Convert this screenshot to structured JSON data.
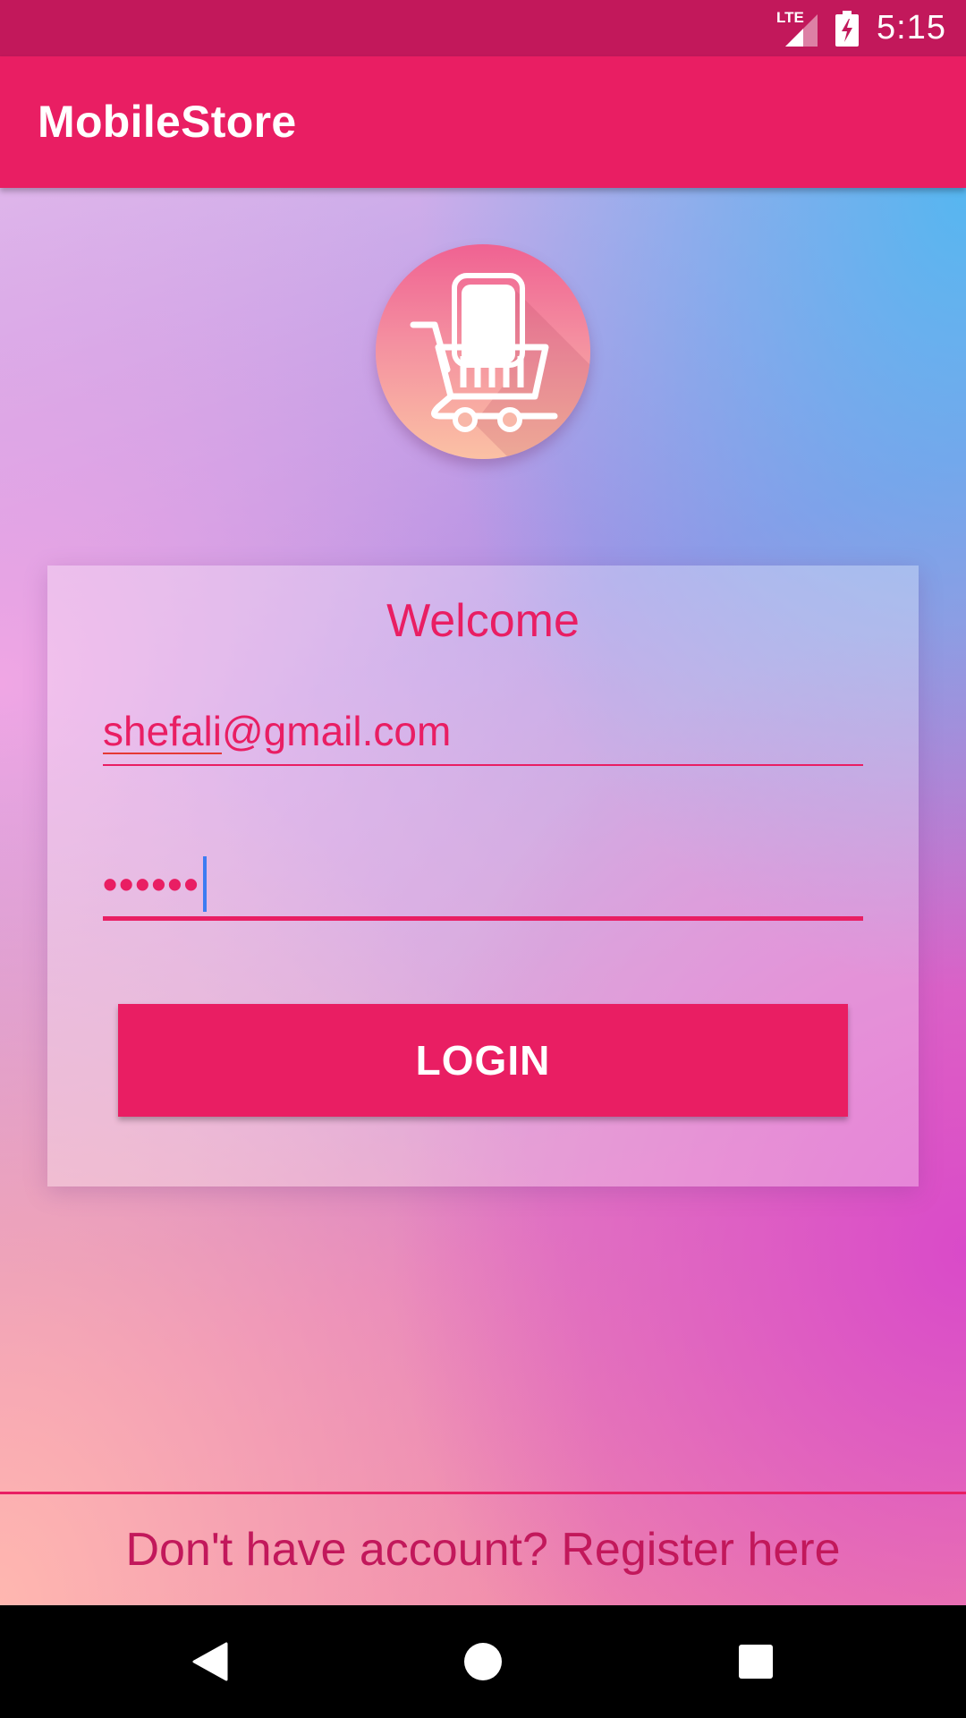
{
  "status_bar": {
    "network": "LTE",
    "time": "5:15",
    "icons": [
      "lte-signal-icon",
      "battery-charging-icon"
    ]
  },
  "app_bar": {
    "title": "MobileStore"
  },
  "logo": {
    "icon": "shopping-cart-icon"
  },
  "login_card": {
    "heading": "Welcome",
    "email": {
      "value_misspelled_part": "shefali",
      "value_rest": "@gmail.com"
    },
    "password": {
      "masked_value": "••••••"
    },
    "login_button_label": "LOGIN"
  },
  "footer": {
    "register_text": "Don't have account? Register here"
  },
  "nav_bar": {
    "icons": [
      "back-icon",
      "home-icon",
      "recents-icon"
    ]
  },
  "colors": {
    "primary": "#e91e63",
    "primary_dark": "#c2185b",
    "caret": "#3d7cf2"
  }
}
